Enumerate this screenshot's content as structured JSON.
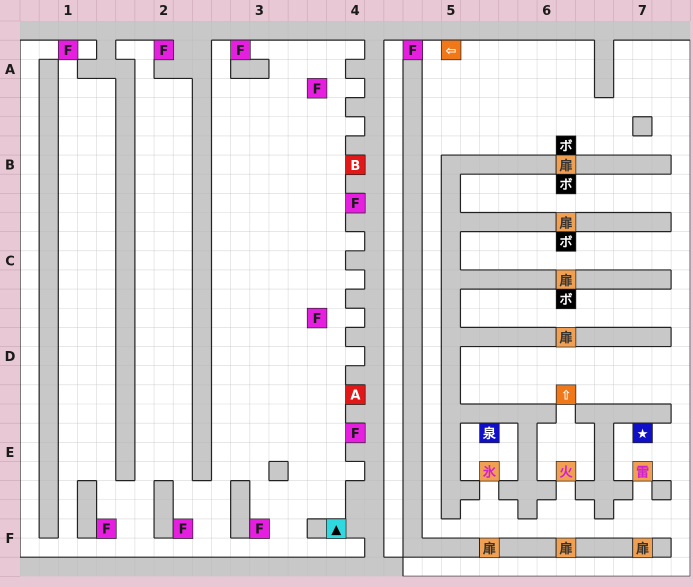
{
  "map": {
    "columns": [
      "1",
      "2",
      "3",
      "4",
      "5",
      "6",
      "7"
    ],
    "rows": [
      "A",
      "B",
      "C",
      "D",
      "E",
      "F"
    ],
    "colors": {
      "header": "#e8c8d4",
      "wall": "#c8c8c8",
      "floor": "#ffffff",
      "grid": "#b9b9b9",
      "magenta": "#e61ee0",
      "red": "#e01818",
      "orange": "#f07818",
      "tan": "#f0a050",
      "black": "#000000",
      "blue": "#1010c8",
      "cyan": "#30d8e0"
    },
    "tiles": {
      "treasure": {
        "label": "F",
        "icon": "treasure-marker"
      },
      "point_a": {
        "label": "A",
        "icon": "point-a-marker"
      },
      "point_b": {
        "label": "B",
        "icon": "point-b-marker"
      },
      "start": {
        "label": "▲",
        "icon": "start-arrow-icon"
      },
      "arrow_left": {
        "label": "⇦",
        "icon": "arrow-left-icon"
      },
      "arrow_up": {
        "label": "⇧",
        "icon": "arrow-up-icon"
      },
      "bo": {
        "label": "ボ",
        "icon": "bo-tile"
      },
      "door": {
        "label": "扉",
        "icon": "door-tile"
      },
      "ice": {
        "label": "氷",
        "icon": "ice-tile"
      },
      "fire": {
        "label": "火",
        "icon": "fire-tile"
      },
      "thunder": {
        "label": "雷",
        "icon": "thunder-tile"
      },
      "spring": {
        "label": "泉",
        "icon": "spring-tile"
      },
      "star": {
        "label": "★",
        "icon": "star-tile"
      }
    }
  }
}
